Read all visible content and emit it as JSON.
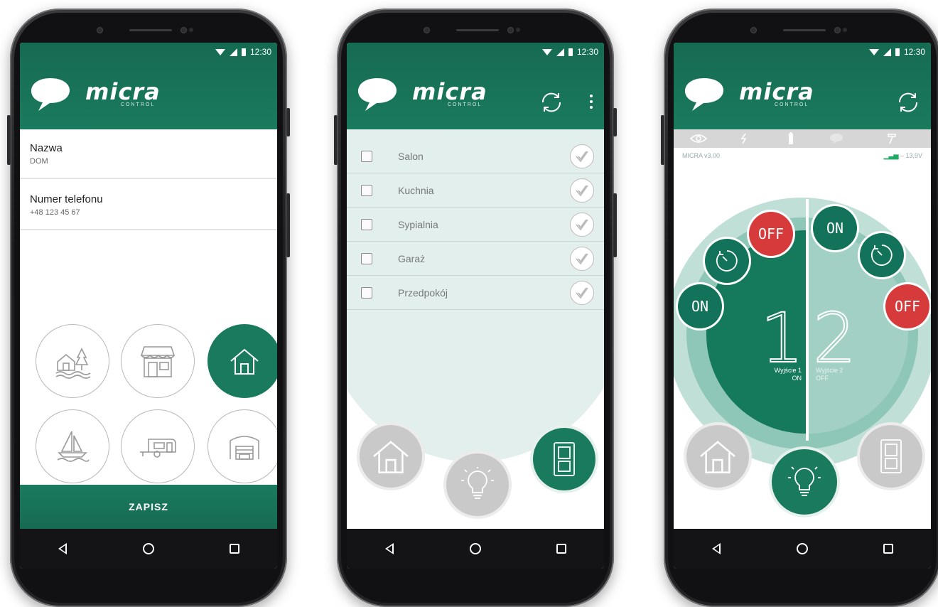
{
  "status": {
    "time": "12:30"
  },
  "brand": {
    "name": "micra",
    "sub": "CONTROL"
  },
  "phone1": {
    "fields": [
      {
        "label": "Nazwa",
        "value": "DOM"
      },
      {
        "label": "Numer telefonu",
        "value": "+48 123 45 67"
      }
    ],
    "types": [
      {
        "icon": "cottage-icon",
        "selected": false
      },
      {
        "icon": "shop-icon",
        "selected": false
      },
      {
        "icon": "house-icon",
        "selected": true
      },
      {
        "icon": "sailboat-icon",
        "selected": false
      },
      {
        "icon": "caravan-icon",
        "selected": false
      },
      {
        "icon": "garage-icon",
        "selected": false
      }
    ],
    "save_label": "ZAPISZ"
  },
  "phone2": {
    "rooms": [
      "Salon",
      "Kuchnia",
      "Sypialnia",
      "Garaż",
      "Przedpokój"
    ]
  },
  "phone3": {
    "device": "MICRA v3.00",
    "voltage": "13,9V",
    "outputs": [
      {
        "number": "1",
        "label": "Wyjście 1",
        "state": "ON"
      },
      {
        "number": "2",
        "label": "Wyjście 2",
        "state": "OFF"
      }
    ],
    "buttons": {
      "on": "ON",
      "off": "OFF"
    }
  },
  "nav": {
    "back": "back-icon",
    "home": "home-circle-icon",
    "recent": "recent-apps-icon"
  },
  "colors": {
    "primary": "#1a7a5d",
    "primary_dark": "#166b52",
    "danger": "#d73a3a",
    "light_green": "#a2d0c4"
  }
}
